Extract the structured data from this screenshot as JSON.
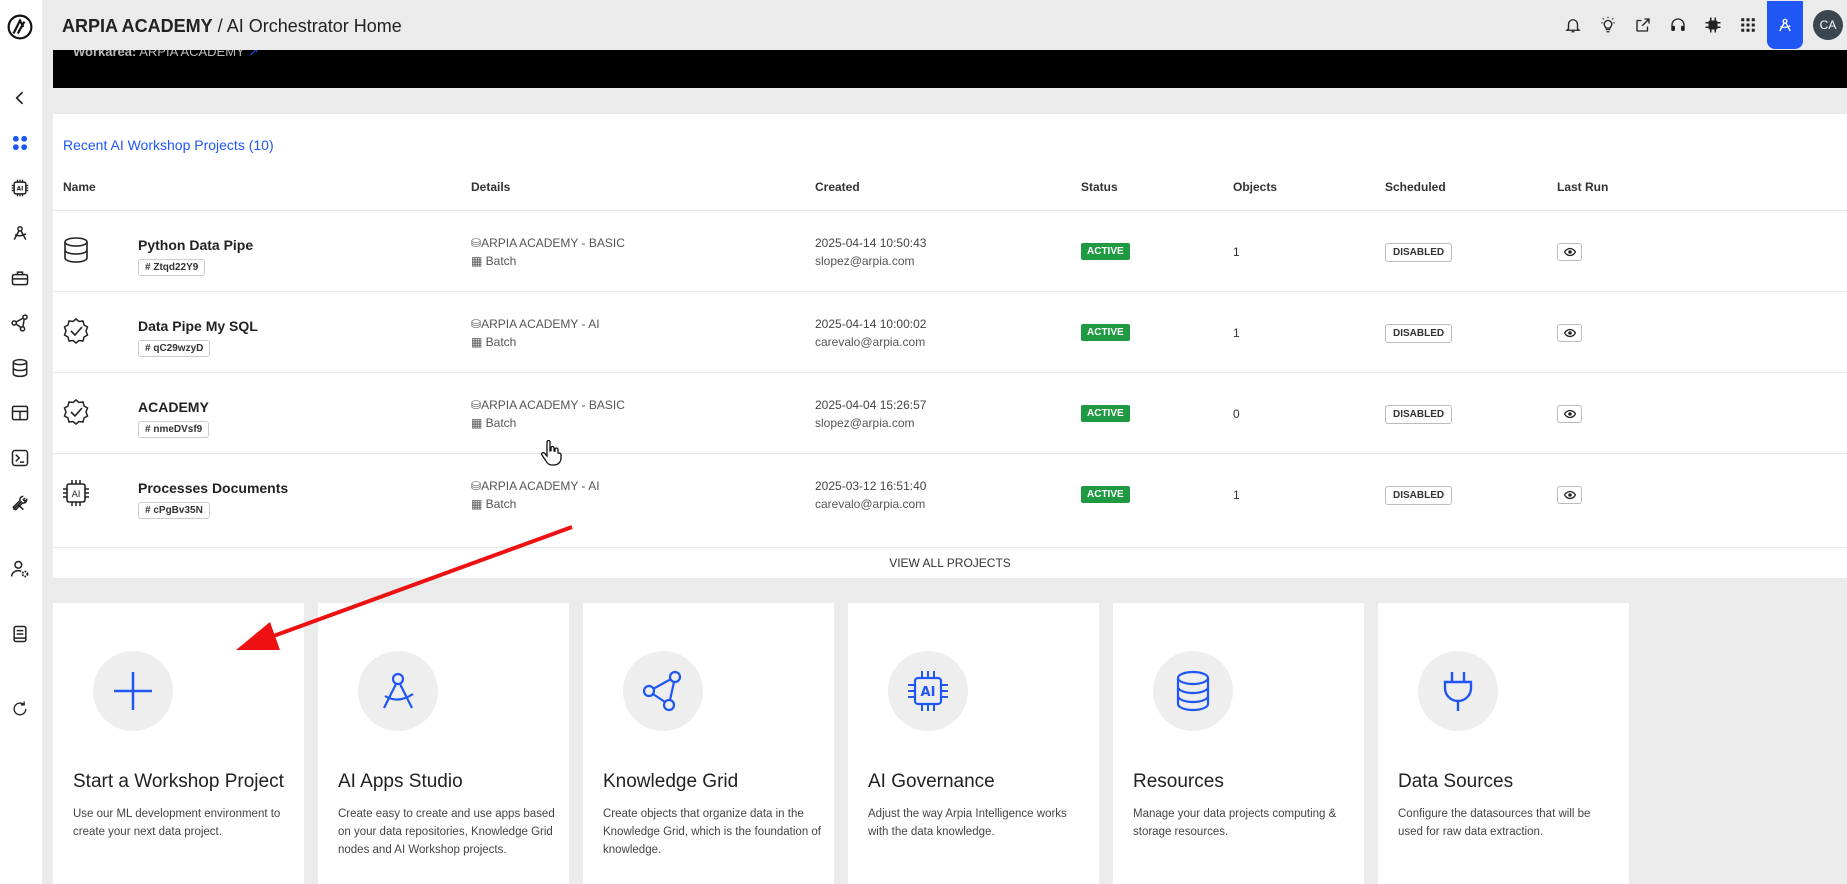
{
  "header": {
    "org": "ARPIA ACADEMY",
    "separator": " / ",
    "page": "AI Orchestrator Home",
    "avatar_initials": "CA"
  },
  "banner": {
    "label": "Workarea:",
    "value": "ARPIA ACADEMY"
  },
  "projects": {
    "title": "Recent AI Workshop Projects (10)",
    "columns": [
      "Name",
      "Details",
      "Created",
      "Status",
      "Objects",
      "Scheduled",
      "Last Run"
    ],
    "rows": [
      {
        "icon": "database-icon",
        "name": "Python Data Pipe",
        "id": "# Ztqd22Y9",
        "repo": "ARPIA ACADEMY - BASIC",
        "mode": "Batch",
        "date": "2025-04-14 10:50:43",
        "user": "slopez@arpia.com",
        "status": "ACTIVE",
        "objects": "1",
        "scheduled": "DISABLED"
      },
      {
        "icon": "badge-check-icon",
        "name": "Data Pipe My SQL",
        "id": "# qC29wzyD",
        "repo": "ARPIA ACADEMY - AI",
        "mode": "Batch",
        "date": "2025-04-14 10:00:02",
        "user": "carevalo@arpia.com",
        "status": "ACTIVE",
        "objects": "1",
        "scheduled": "DISABLED"
      },
      {
        "icon": "badge-check-icon",
        "name": "ACADEMY",
        "id": "# nmeDVsf9",
        "repo": "ARPIA ACADEMY - BASIC",
        "mode": "Batch",
        "date": "2025-04-04 15:26:57",
        "user": "slopez@arpia.com",
        "status": "ACTIVE",
        "objects": "0",
        "scheduled": "DISABLED"
      },
      {
        "icon": "ai-chip-icon",
        "name": "Processes Documents",
        "id": "# cPgBv35N",
        "repo": "ARPIA ACADEMY - AI",
        "mode": "Batch",
        "date": "2025-03-12 16:51:40",
        "user": "carevalo@arpia.com",
        "status": "ACTIVE",
        "objects": "1",
        "scheduled": "DISABLED"
      }
    ],
    "view_all": "VIEW ALL PROJECTS"
  },
  "cards": [
    {
      "icon": "plus-icon",
      "title": "Start a Workshop Project",
      "desc": "Use our ML development environment to create your next data project."
    },
    {
      "icon": "compass-icon",
      "title": "AI Apps Studio",
      "desc": "Create easy to create and use apps based on your data repositories, Knowledge Grid nodes and AI Workshop projects."
    },
    {
      "icon": "share-nodes-icon",
      "title": "Knowledge Grid",
      "desc": "Create objects that organize data in the Knowledge Grid, which is the foundation of knowledge."
    },
    {
      "icon": "ai-chip-icon",
      "title": "AI Governance",
      "desc": "Adjust the way Arpia Intelligence works with the data knowledge."
    },
    {
      "icon": "database-icon",
      "title": "Resources",
      "desc": "Manage your data projects computing & storage resources."
    },
    {
      "icon": "plug-icon",
      "title": "Data Sources",
      "desc": "Configure the datasources that will be used for raw data extraction."
    }
  ],
  "colors": {
    "accent": "#1f56f5",
    "active": "#1f9a43",
    "annotation_arrow": "#ee1111"
  }
}
